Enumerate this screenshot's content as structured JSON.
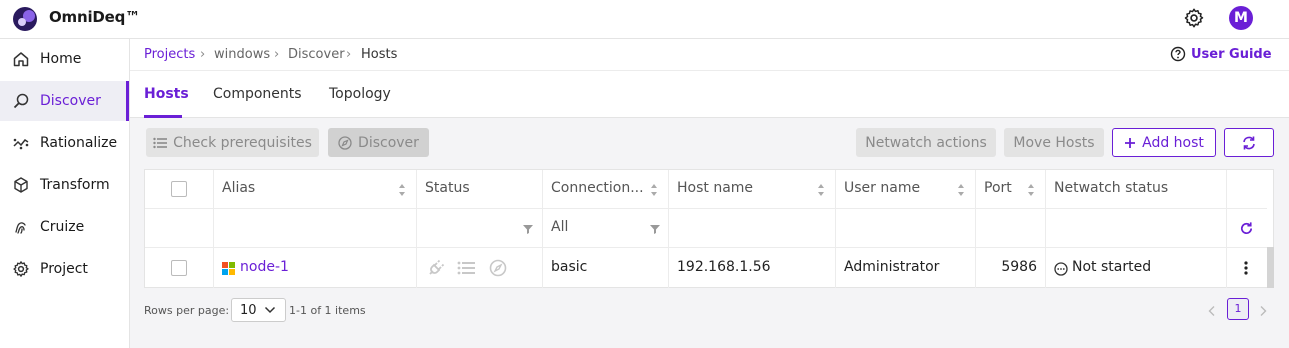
{
  "app": {
    "name": "OmniDeq™",
    "avatar_initial": "M",
    "accent": "#6a1fd6"
  },
  "sidebar": {
    "items": [
      {
        "label": "Home",
        "icon": "home-icon"
      },
      {
        "label": "Discover",
        "icon": "discover-icon",
        "active": true
      },
      {
        "label": "Rationalize",
        "icon": "rationalize-icon"
      },
      {
        "label": "Transform",
        "icon": "cube-icon"
      },
      {
        "label": "Cruize",
        "icon": "fingerprint-icon"
      },
      {
        "label": "Project",
        "icon": "gear-icon"
      }
    ]
  },
  "breadcrumb": {
    "items": [
      "Projects",
      "windows",
      "Discover",
      "Hosts"
    ],
    "separator": "›"
  },
  "user_guide": "User Guide",
  "tabs": [
    {
      "label": "Hosts",
      "active": true
    },
    {
      "label": "Components"
    },
    {
      "label": "Topology"
    }
  ],
  "toolbar": {
    "check_prerequisites": "Check prerequisites",
    "discover": "Discover",
    "netwatch_actions": "Netwatch actions",
    "move_hosts": "Move Hosts",
    "add_host": "Add host"
  },
  "table": {
    "columns": [
      "Alias",
      "Status",
      "Connection...",
      "Host name",
      "User name",
      "Port",
      "Netwatch status"
    ],
    "filters": {
      "connection": "All"
    },
    "rows": [
      {
        "alias": "node-1",
        "connection": "basic",
        "host_name": "192.168.1.56",
        "user_name": "Administrator",
        "port": "5986",
        "netwatch_status": "Not started"
      }
    ]
  },
  "pagination": {
    "rows_per_page_label": "Rows per page:",
    "rows_per_page": "10",
    "range": "1-1 of 1 items",
    "current_page": "1"
  }
}
